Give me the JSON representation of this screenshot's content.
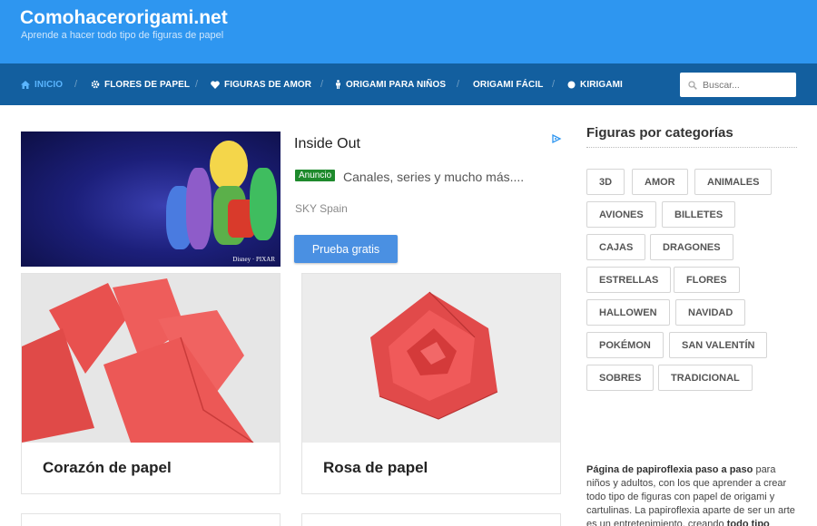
{
  "site": {
    "title": "Comohacerorigami.net",
    "tagline": "Aprende a hacer todo tipo de figuras de papel"
  },
  "nav": {
    "items": [
      {
        "label": "INICIO",
        "icon": "home-icon",
        "active": true
      },
      {
        "label": "FLORES DE PAPEL",
        "icon": "gear-icon"
      },
      {
        "label": "FIGURAS DE AMOR",
        "icon": "heart-icon"
      },
      {
        "label": "ORIGAMI PARA NIÑOS",
        "icon": "child-icon"
      },
      {
        "label": "ORIGAMI FÁCIL",
        "icon": ""
      },
      {
        "label": "KIRIGAMI",
        "icon": "circle-icon"
      }
    ],
    "separator": "/",
    "search_placeholder": "Buscar..."
  },
  "ad": {
    "title": "Inside Out",
    "badge": "Anuncio",
    "description": "Canales, series y mucho más....",
    "advertiser": "SKY Spain",
    "cta": "Prueba gratis",
    "image_logo": "Disney · PIXAR"
  },
  "posts": [
    {
      "title": "Corazón de papel"
    },
    {
      "title": "Rosa de papel"
    }
  ],
  "sidebar": {
    "title": "Figuras por categorías",
    "tags": [
      "3D",
      "AMOR",
      "ANIMALES",
      "AVIONES",
      "BILLETES",
      "CAJAS",
      "DRAGONES",
      "ESTRELLAS",
      "FLORES",
      "HALLOWEN",
      "NAVIDAD",
      "POKÉMON",
      "SAN VALENTÍN",
      "SOBRES",
      "TRADICIONAL"
    ],
    "about_bold": "Página de papiroflexia paso a paso",
    "about_text": " para niños y adultos, con los que aprender a crear todo tipo de figuras con papel de origami y cartulinas. La papiroflexia aparte de ser un arte es un entretenimiento, creando ",
    "about_bold_2": "todo tipo"
  },
  "colors": {
    "header": "#2e96f0",
    "nav": "#135f9f",
    "nav_active": "#5ab5ff",
    "ad_badge": "#1e8a2c",
    "cta": "#4a90e2"
  }
}
